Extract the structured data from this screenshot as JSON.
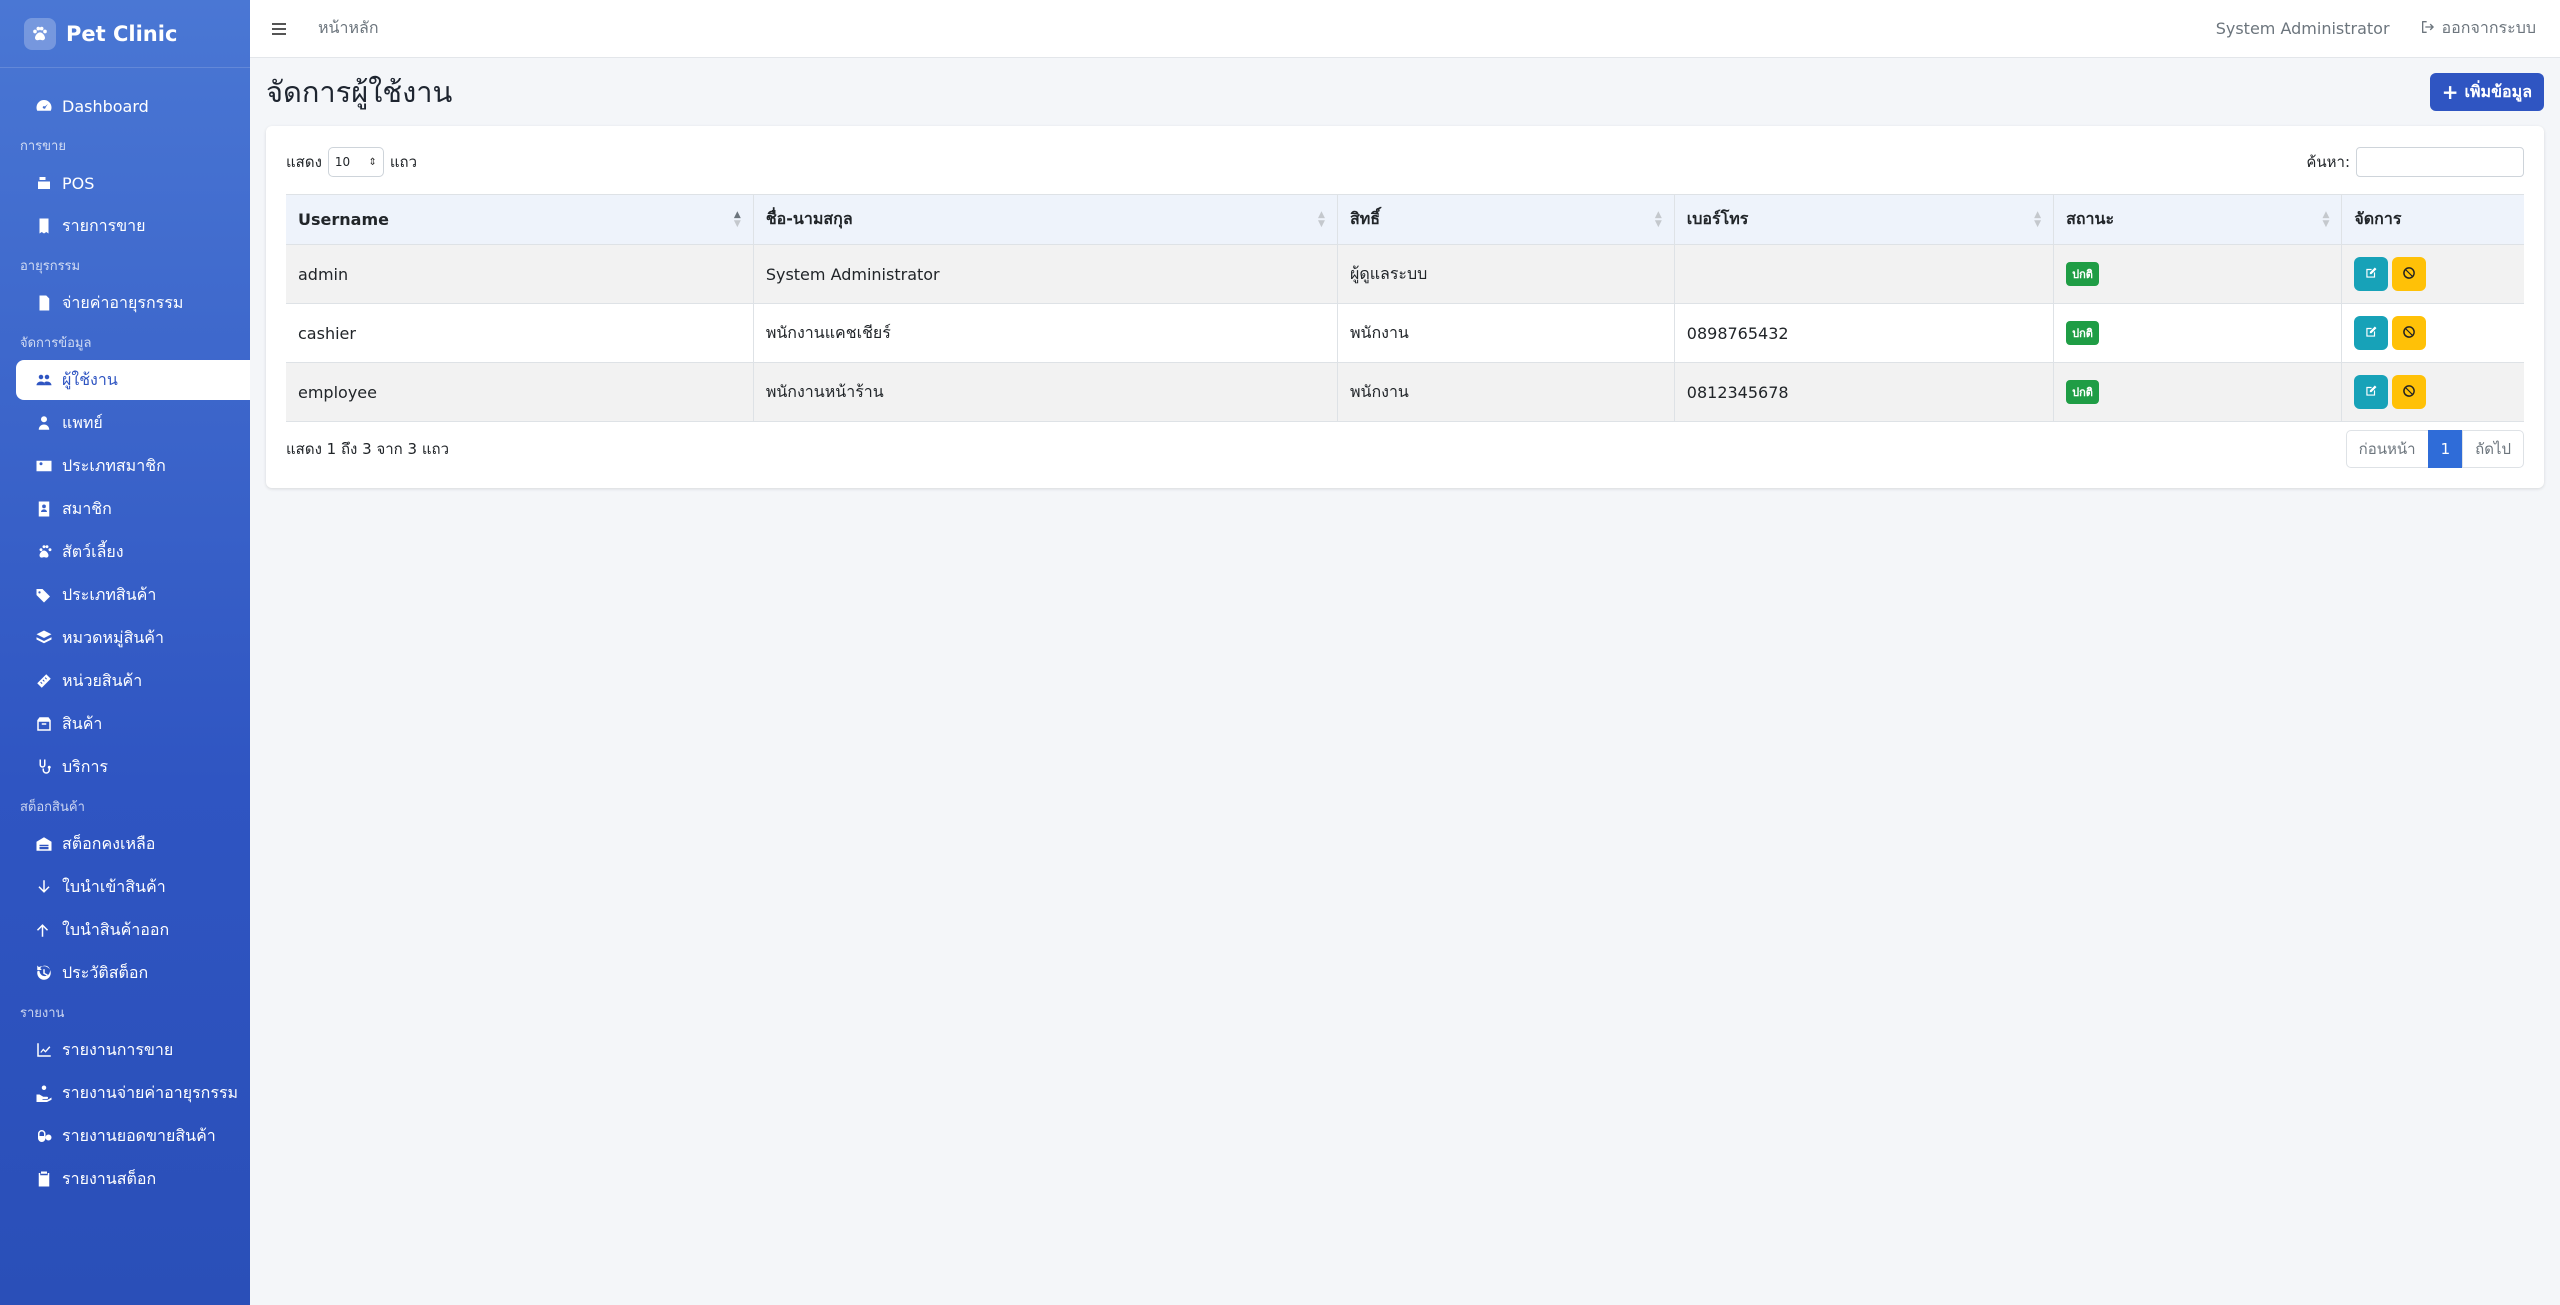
{
  "app": {
    "name": "Pet Clinic"
  },
  "sidebar": {
    "dashboard": "Dashboard",
    "sections": [
      {
        "title": "การขาย",
        "items": [
          {
            "label": "POS",
            "icon": "cash-register-icon"
          },
          {
            "label": "รายการขาย",
            "icon": "receipt-icon"
          }
        ]
      },
      {
        "title": "อายุรกรรม",
        "items": [
          {
            "label": "จ่ายค่าอายุรกรรม",
            "icon": "invoice-icon"
          }
        ]
      },
      {
        "title": "จัดการข้อมูล",
        "items": [
          {
            "label": "ผู้ใช้งาน",
            "icon": "users-icon",
            "active": true
          },
          {
            "label": "แพทย์",
            "icon": "doctor-icon"
          },
          {
            "label": "ประเภทสมาชิก",
            "icon": "id-card-icon"
          },
          {
            "label": "สมาชิก",
            "icon": "member-icon"
          },
          {
            "label": "สัตว์เลี้ยง",
            "icon": "paw-icon"
          },
          {
            "label": "ประเภทสินค้า",
            "icon": "tags-icon"
          },
          {
            "label": "หมวดหมู่สินค้า",
            "icon": "layers-icon"
          },
          {
            "label": "หน่วยสินค้า",
            "icon": "ruler-icon"
          },
          {
            "label": "สินค้า",
            "icon": "box-icon"
          },
          {
            "label": "บริการ",
            "icon": "stethoscope-icon"
          }
        ]
      },
      {
        "title": "สต็อกสินค้า",
        "items": [
          {
            "label": "สต็อกคงเหลือ",
            "icon": "warehouse-icon"
          },
          {
            "label": "ใบนำเข้าสินค้า",
            "icon": "arrow-down-icon"
          },
          {
            "label": "ใบนำสินค้าออก",
            "icon": "arrow-up-icon"
          },
          {
            "label": "ประวัติสต็อก",
            "icon": "history-icon"
          }
        ]
      },
      {
        "title": "รายงาน",
        "items": [
          {
            "label": "รายงานการขาย",
            "icon": "chart-line-icon"
          },
          {
            "label": "รายงานจ่ายค่าอายุรกรรม",
            "icon": "hand-money-icon"
          },
          {
            "label": "รายงานยอดขายสินค้า",
            "icon": "pills-icon"
          },
          {
            "label": "รายงานสต็อก",
            "icon": "clipboard-icon"
          }
        ]
      }
    ]
  },
  "topbar": {
    "home": "หน้าหลัก",
    "user": "System Administrator",
    "logout": "ออกจากระบบ"
  },
  "page": {
    "title": "จัดการผู้ใช้งาน",
    "add_button": "เพิ่มข้อมูล"
  },
  "table_controls": {
    "show_prefix": "แสดง",
    "page_length": "10",
    "show_suffix": "แถว",
    "search_label": "ค้นหา:"
  },
  "table": {
    "columns": [
      "Username",
      "ชื่อ-นามสกุล",
      "สิทธิ์",
      "เบอร์โทร",
      "สถานะ",
      "จัดการ"
    ],
    "rows": [
      {
        "username": "admin",
        "fullname": "System Administrator",
        "role": "ผู้ดูแลระบบ",
        "phone": "",
        "status": "ปกติ"
      },
      {
        "username": "cashier",
        "fullname": "พนักงานแคชเชียร์",
        "role": "พนักงาน",
        "phone": "0898765432",
        "status": "ปกติ"
      },
      {
        "username": "employee",
        "fullname": "พนักงานหน้าร้าน",
        "role": "พนักงาน",
        "phone": "0812345678",
        "status": "ปกติ"
      }
    ]
  },
  "footer": {
    "info": "แสดง 1 ถึง 3 จาก 3 แถว",
    "prev": "ก่อนหน้า",
    "page": "1",
    "next": "ถัดไป"
  },
  "colors": {
    "sidebar": "#2f55c2",
    "primary": "#2f55c2",
    "edit": "#17a2b8",
    "disable": "#ffc107",
    "status": "#1f9d45"
  }
}
